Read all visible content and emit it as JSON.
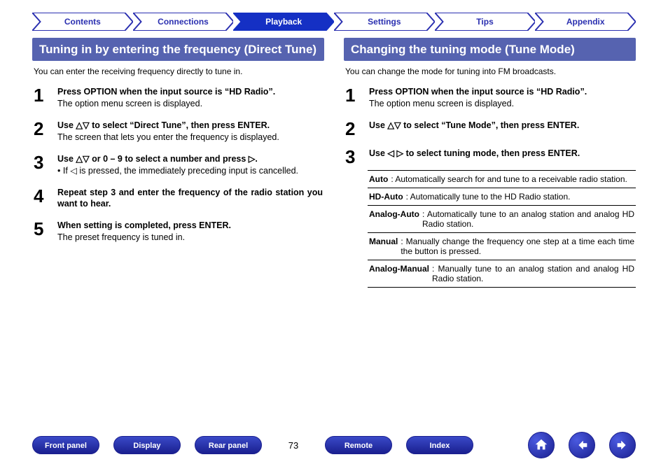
{
  "nav": {
    "tabs": [
      {
        "label": "Contents",
        "active": false
      },
      {
        "label": "Connections",
        "active": false
      },
      {
        "label": "Playback",
        "active": true
      },
      {
        "label": "Settings",
        "active": false
      },
      {
        "label": "Tips",
        "active": false
      },
      {
        "label": "Appendix",
        "active": false
      }
    ]
  },
  "left": {
    "heading": "Tuning in by entering the frequency (Direct Tune)",
    "intro": "You can enter the receiving frequency directly to tune in.",
    "steps": [
      {
        "num": "1",
        "title": "Press OPTION when the input source is “HD Radio”.",
        "sub": "The option menu screen is displayed."
      },
      {
        "num": "2",
        "title": "Use △▽ to select “Direct Tune”, then press ENTER.",
        "sub": "The screen that lets you enter the frequency is displayed."
      },
      {
        "num": "3",
        "title": "Use △▽ or 0 – 9 to select a number and press ▷.",
        "bullet": "If ◁ is pressed, the immediately preceding input is cancelled."
      },
      {
        "num": "4",
        "title": "Repeat step 3 and enter the frequency of the radio station you want to hear."
      },
      {
        "num": "5",
        "title": "When setting is completed, press ENTER.",
        "sub": "The preset frequency is tuned in."
      }
    ]
  },
  "right": {
    "heading": "Changing the tuning mode (Tune Mode)",
    "intro": "You can change the mode for tuning into FM broadcasts.",
    "steps": [
      {
        "num": "1",
        "title": "Press OPTION when the input source is “HD Radio”.",
        "sub": "The option menu screen is displayed."
      },
      {
        "num": "2",
        "title": "Use △▽ to select “Tune Mode”, then press ENTER."
      },
      {
        "num": "3",
        "title": "Use ◁ ▷ to select tuning mode, then press ENTER."
      }
    ],
    "modes": [
      {
        "label": "Auto",
        "desc": ": Automatically search for and tune to a receivable radio station."
      },
      {
        "label": "HD-Auto",
        "desc": ": Automatically tune to the HD Radio station."
      },
      {
        "label": "Analog-Auto",
        "desc": ": Automatically tune to an analog station and analog HD Radio station."
      },
      {
        "label": "Manual",
        "desc": ": Manually change the frequency one step at a time each time the button is pressed."
      },
      {
        "label": "Analog-Manual",
        "desc": ": Manually tune to an analog station and analog HD Radio station."
      }
    ]
  },
  "footer": {
    "links": [
      {
        "label": "Front panel"
      },
      {
        "label": "Display"
      },
      {
        "label": "Rear panel"
      }
    ],
    "page": "73",
    "links2": [
      {
        "label": "Remote"
      },
      {
        "label": "Index"
      }
    ]
  }
}
